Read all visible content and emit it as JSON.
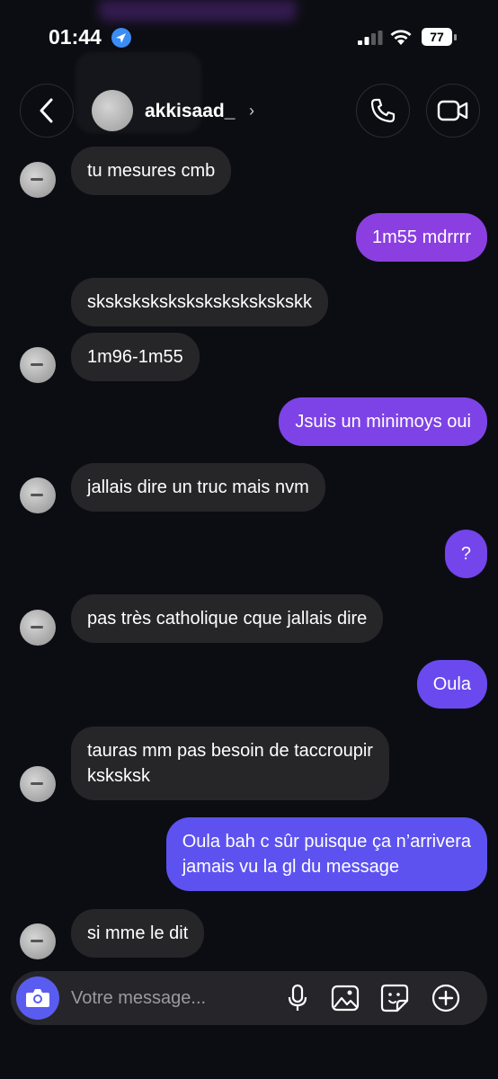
{
  "status_bar": {
    "time": "01:44",
    "battery": "77"
  },
  "header": {
    "username": "akkisaad_",
    "chevron": "›"
  },
  "colors": {
    "accent": "#5a5cf0",
    "received_bubble": "#262629"
  },
  "messages": [
    {
      "id": "m1",
      "direction": "received",
      "lines": [
        "tu mesures cmb"
      ]
    },
    {
      "id": "m2",
      "direction": "sent",
      "lines": [
        "1m55 mdrrrr"
      ],
      "color": "#8b3fe0"
    },
    {
      "id": "m3",
      "direction": "received",
      "lines": [
        "skskskskskskskskskskskskk"
      ]
    },
    {
      "id": "m4",
      "direction": "received",
      "lines": [
        "1m96-1m55"
      ]
    },
    {
      "id": "m5",
      "direction": "sent",
      "lines": [
        "Jsuis un minimoys oui"
      ],
      "color": "#7e43e6"
    },
    {
      "id": "m6",
      "direction": "received",
      "lines": [
        "jallais dire un truc mais nvm"
      ]
    },
    {
      "id": "m7",
      "direction": "sent",
      "lines": [
        "?"
      ],
      "color": "#7345ea"
    },
    {
      "id": "m8",
      "direction": "received",
      "lines": [
        "pas très catholique cque jallais dire"
      ]
    },
    {
      "id": "m9",
      "direction": "sent",
      "lines": [
        "Oula"
      ],
      "color": "#6a4aee"
    },
    {
      "id": "m10",
      "direction": "received",
      "lines": [
        "tauras mm pas besoin de taccroupir",
        "ksksksk"
      ]
    },
    {
      "id": "m11",
      "direction": "sent",
      "lines": [
        "Oula bah c sûr puisque ça n’arrivera",
        "jamais vu la gl du message"
      ],
      "color": "#5d52f0"
    },
    {
      "id": "m12",
      "direction": "received",
      "lines": [
        "si mme le dit"
      ]
    }
  ],
  "composer": {
    "placeholder": "Votre message..."
  },
  "icons": {
    "back": "chevron-left-icon",
    "call": "phone-icon",
    "video": "video-camera-icon",
    "camera": "camera-icon",
    "mic": "microphone-icon",
    "gallery": "image-icon",
    "sticker": "sticker-icon",
    "add": "plus-circle-icon"
  }
}
